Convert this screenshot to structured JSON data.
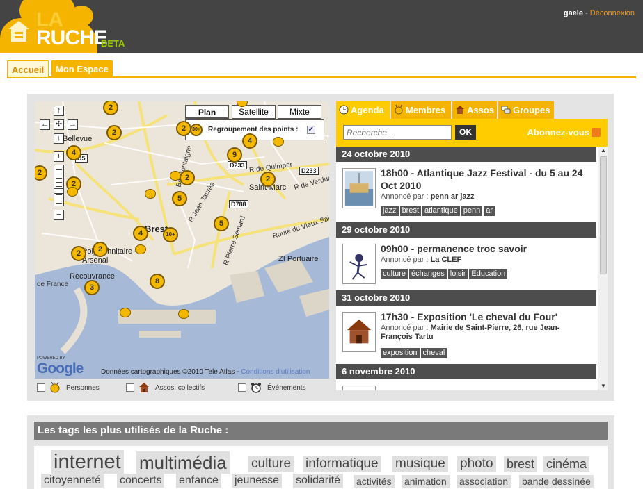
{
  "header": {
    "logo_la": "LA",
    "logo_ruche": "RUCHE",
    "logo_beta": "BETA",
    "user_name": "gaele",
    "separator": "-",
    "logout_label": "Déconnexion"
  },
  "nav": {
    "tabs": [
      {
        "label": "Accueil",
        "active": true
      },
      {
        "label": "Mon Espace",
        "active": false
      }
    ]
  },
  "map": {
    "types": [
      "Plan",
      "Satellite",
      "Mixte"
    ],
    "selected_type": "Plan",
    "regroup_label": "Regroupement des points :",
    "regroup_icon_text": "30+",
    "regroup_checked": true,
    "cluster_counts": [
      "2",
      "2",
      "2",
      "4",
      "2",
      "9",
      "4",
      "2",
      "2",
      "5",
      "5",
      "4",
      "10+",
      "2",
      "2",
      "3",
      "8",
      "2"
    ],
    "place_labels": [
      "Bellevue",
      "Saint-Marc",
      "R de Quimper",
      "R de Verdun",
      "Bd Montaigne",
      "R Jean Jaurès",
      "Brest",
      "Route du Vieux Saint",
      "Polytechnitaire - Arsenal",
      "Recouvrance",
      "ZI Portuaire",
      "R Pierre Sémard",
      "de France"
    ],
    "road_labels": [
      "D5",
      "D233",
      "D233",
      "D788"
    ],
    "powered_by": "POWERED BY",
    "google": "Google",
    "copyright": "Données cartographiques ©2010 Tele Atlas -",
    "terms_link": "Conditions d'utilisation",
    "legend": [
      {
        "label": "Personnes",
        "icon": "bee-icon"
      },
      {
        "label": "Assos, collectifs",
        "icon": "house-icon"
      },
      {
        "label": "Événements",
        "icon": "alarm-clock-icon"
      }
    ]
  },
  "panel": {
    "tabs": [
      {
        "label": "Agenda",
        "icon": "clock-icon",
        "active": true
      },
      {
        "label": "Membres",
        "icon": "bee-icon",
        "active": false
      },
      {
        "label": "Assos",
        "icon": "house-icon",
        "active": false
      },
      {
        "label": "Groupes",
        "icon": "speech-bubbles-icon",
        "active": false
      }
    ],
    "search_placeholder": "Recherche ...",
    "search_button": "OK",
    "subscribe_label": "Abonnez-vous",
    "announced_by": "Annoncé par :",
    "events": [
      {
        "date": "24 octobre 2010",
        "title": "18h00 - Atlantique Jazz Festival - du 5 au 24 Oct 2010",
        "author": "penn ar jazz",
        "tags": [
          "jazz",
          "brest",
          "atlantique",
          "penn",
          "ar"
        ]
      },
      {
        "date": "29 octobre 2010",
        "title": "09h00 - permanence troc savoir",
        "author": "La CLEF",
        "tags": [
          "culture",
          "échanges",
          "loisir",
          "Education"
        ]
      },
      {
        "date": "31 octobre 2010",
        "title": "17h30 - Exposition 'Le cheval du Four'",
        "author": "Mairie de Saint-Pierre, 26, rue Jean-François Tartu",
        "tags": [
          "exposition",
          "cheval"
        ]
      },
      {
        "date": "6 novembre 2010"
      }
    ]
  },
  "tags_section": {
    "title": "Les tags les plus utilisés de la Ruche :",
    "tags": [
      "internet",
      "multimédia",
      "culture",
      "informatique",
      "musique",
      "photo",
      "brest",
      "cinéma",
      "citoyenneté",
      "concerts",
      "enfance",
      "jeunesse",
      "solidarité",
      "activités",
      "animation",
      "association",
      "bande dessinée"
    ]
  }
}
